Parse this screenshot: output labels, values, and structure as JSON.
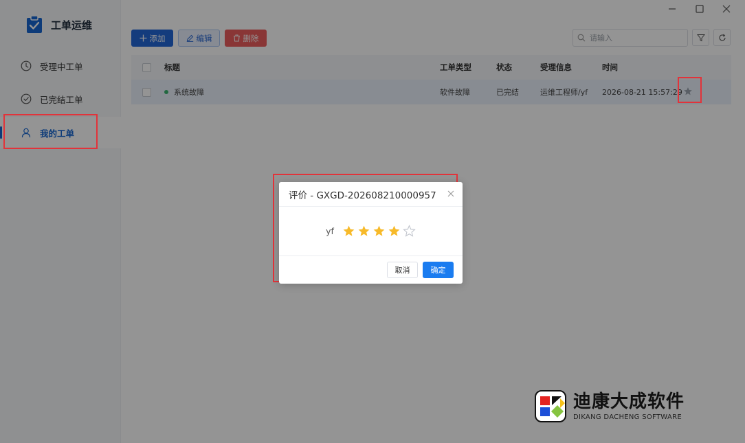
{
  "app": {
    "title": "工单运维"
  },
  "sidebar": {
    "items": [
      {
        "label": "受理中工单",
        "icon": "clock-icon"
      },
      {
        "label": "已完结工单",
        "icon": "check-circle-icon"
      },
      {
        "label": "我的工单",
        "icon": "user-icon",
        "active": true
      }
    ]
  },
  "toolbar": {
    "add_label": "添加",
    "edit_label": "编辑",
    "delete_label": "删除",
    "search_placeholder": "请输入"
  },
  "table": {
    "columns": [
      "标题",
      "工单类型",
      "状态",
      "受理信息",
      "时间"
    ],
    "rows": [
      {
        "title": "系统故障",
        "type": "软件故障",
        "status": "已完结",
        "handler": "运维工程师/yf",
        "time": "2026-08-21 15:57:29"
      }
    ]
  },
  "dialog": {
    "title": "评价 - GXGD-202608210000957",
    "user": "yf",
    "rating": 4,
    "max_rating": 5,
    "cancel_label": "取消",
    "ok_label": "确定"
  },
  "watermark": {
    "cn": "迪康大成软件",
    "en": "DIKANG DACHENG SOFTWARE"
  },
  "colors": {
    "primary": "#2468d8",
    "danger": "#ec5d5d",
    "star": "#f7ba2a",
    "highlight": "#e2333a"
  }
}
